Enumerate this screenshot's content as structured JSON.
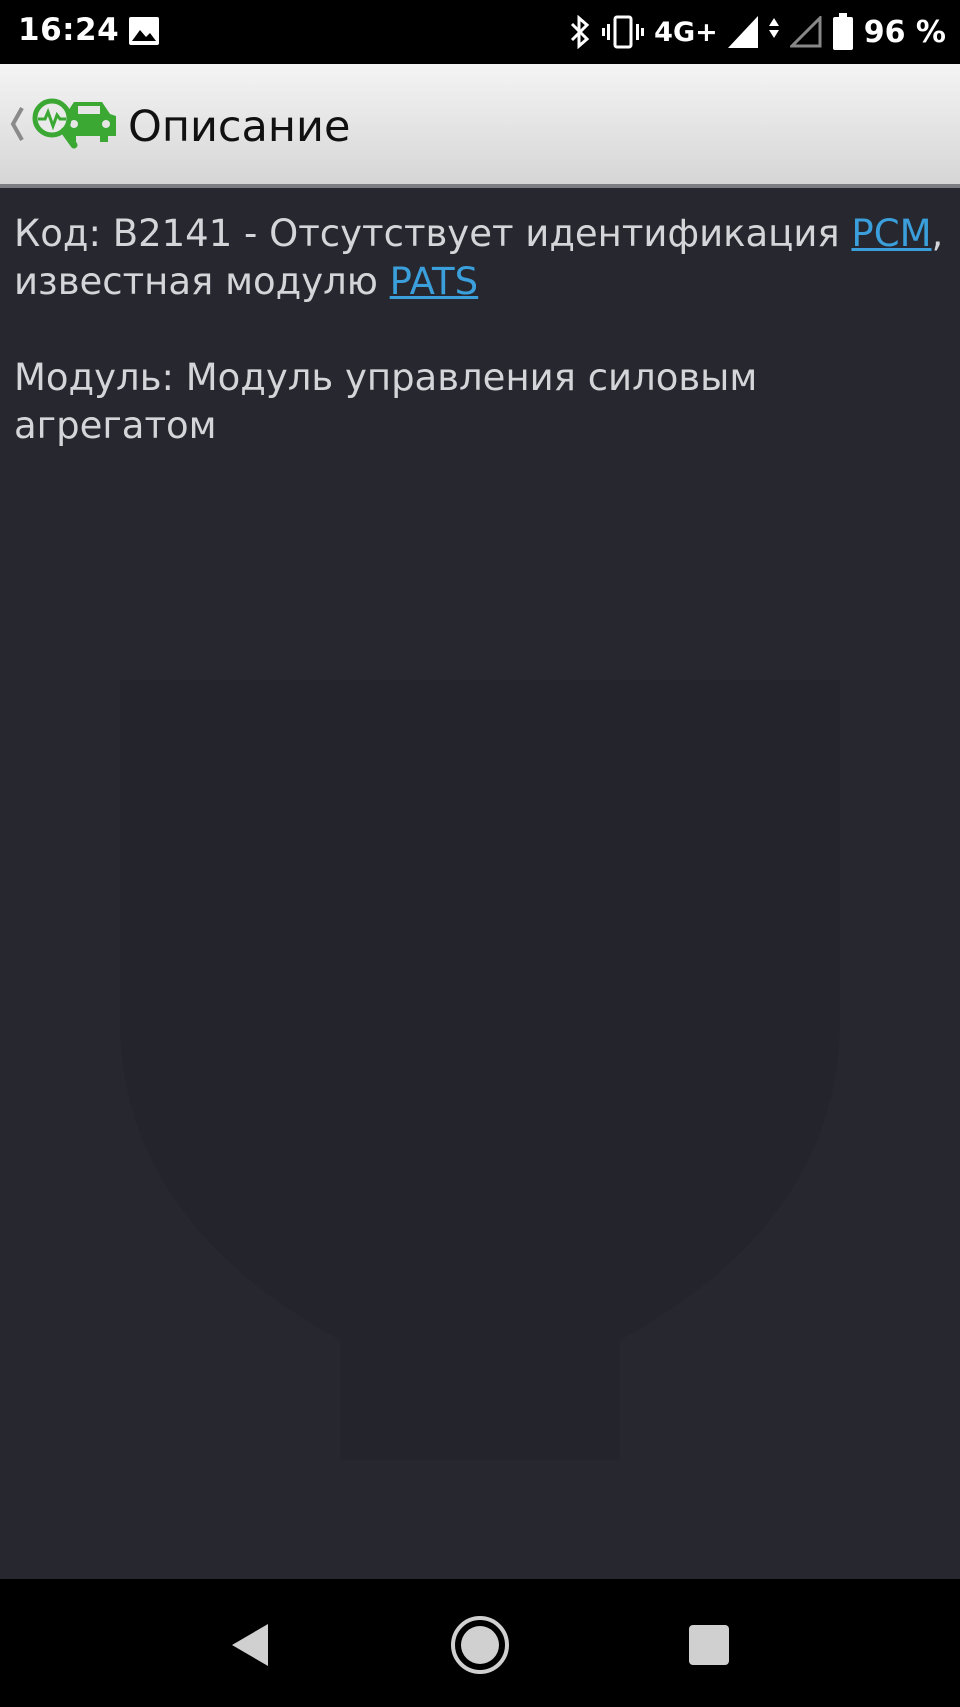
{
  "status_bar": {
    "time": "16:24",
    "network": "4G+",
    "battery_percent": "96 %",
    "icons": [
      "gallery-icon",
      "bluetooth-icon",
      "vibrate-icon",
      "signal-icon",
      "data-arrows-icon",
      "signal-empty-icon",
      "battery-icon"
    ]
  },
  "action_bar": {
    "title": "Описание",
    "logo_icon": "car-diagnostic-logo-icon",
    "logo_color": "#3aa832"
  },
  "content": {
    "code_prefix": "Код: B2141 - Отсутствует идентификация ",
    "link_pcm": "PCM",
    "code_middle": ", известная модулю ",
    "link_pats": "PATS",
    "module_text": "Модуль: Модуль управления силовым агрегатом"
  },
  "colors": {
    "background": "#26272f",
    "text": "#d4d5d8",
    "link": "#3a9fdb"
  },
  "nav_bar": {
    "icons": [
      "back-triangle-icon",
      "home-circle-icon",
      "recents-square-icon"
    ]
  }
}
